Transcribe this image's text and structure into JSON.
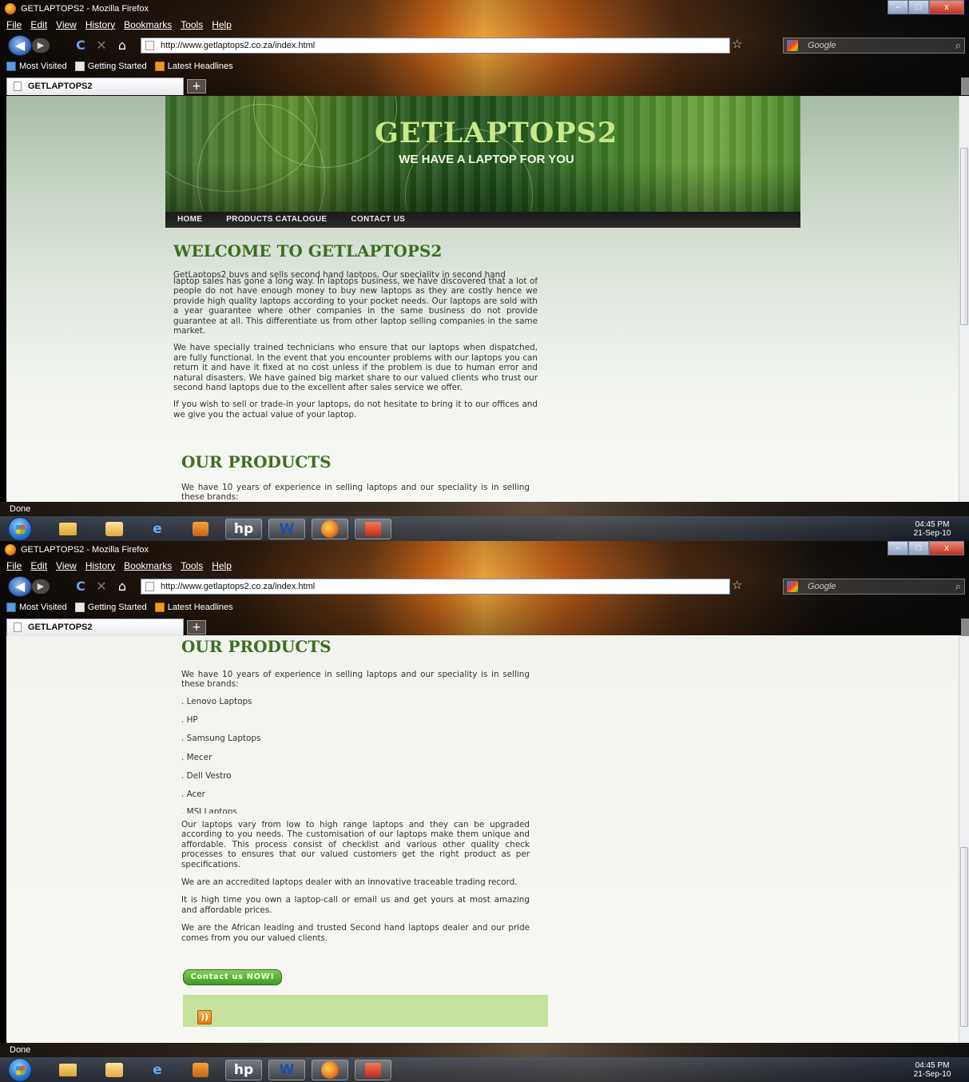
{
  "window": {
    "title": "GETLAPTOPS2 - Mozilla Firefox",
    "buttons": {
      "minimize": "–",
      "maximize": "□",
      "close": "x"
    }
  },
  "menu": [
    "File",
    "Edit",
    "View",
    "History",
    "Bookmarks",
    "Tools",
    "Help"
  ],
  "toolbar": {
    "url": "http://www.getlaptops2.co.za/index.html",
    "search_placeholder": "Google",
    "back_glyph": "◀",
    "forward_glyph": "▶",
    "reload_glyph": "C",
    "stop_glyph": "✕",
    "home_glyph": "⌂",
    "star_glyph": "☆",
    "search_glyph": "⌕"
  },
  "bookmarks": [
    "Most Visited",
    "Getting Started",
    "Latest Headlines"
  ],
  "tabs": [
    {
      "label": "GETLAPTOPS2"
    }
  ],
  "newtab_label": "+",
  "site": {
    "title": "GETLAPTOPS2",
    "tagline": "WE HAVE A LAPTOP FOR YOU",
    "nav": [
      "HOME",
      "PRODUCTS CATALOGUE",
      "CONTACT US"
    ],
    "welcome_heading": "WELCOME TO GETLAPTOPS2",
    "intro_clipped_line": "GetLaptops2 buys and sells second hand laptops. Our speciality in second hand",
    "intro_p1": "laptop sales has gone a long way. In laptops business, we have discovered that a lot of people do not have enough money to buy new laptops as they are costly hence we provide high quality laptops according to your pocket needs. Our laptops are sold with a year guarantee where other companies in the same business do not provide guarantee at all. This differentiate us from other laptop selling companies in the same market.",
    "intro_p2": "We have specially trained technicians who ensure that our laptops when dispatched, are fully functional. In the event that you encounter problems with our laptops you can return it and have it fixed at no cost unless if the problem is due to human error and natural disasters. We have gained big market share to our valued clients who trust our second hand laptops due to the excellent after sales service we offer.",
    "intro_p3": "If you wish to sell or trade-in your laptops, do not hesitate to bring it to our offices and we give you the actual value of your laptop.",
    "products_heading": "OUR PRODUCTS",
    "products_intro": "We have 10 years of experience in selling laptops and our speciality is in selling these brands:",
    "brands": [
      ". Lenovo Laptops",
      ". HP",
      ". Samsung Laptops",
      ". Mecer",
      ". Dell Vestro",
      ". Acer"
    ],
    "brand_clipped": ". MSI Laptops",
    "products_p1": "Our laptops vary from low to high range laptops and they can be upgraded according to you needs. The customisation of our laptops make them unique and affordable. This process consist of checklist and various other quality check processes to ensures that our valued customers get the right product as per specifications.",
    "products_p2": "We are an accredited laptops dealer with an innovative traceable trading record.",
    "products_p3": "It is high time you own a laptop-call or email us and get yours at most amazing and affordable prices.",
    "products_p4": "We are the African leading and trusted Second hand laptops dealer and our pride comes from you our valued clients.",
    "contact_button": "Contact us NOW!",
    "rss_glyph": "))"
  },
  "status": "Done",
  "clock": {
    "time": "04:45 PM",
    "date": "21-Sep-10"
  },
  "taskbar_glyphs": {
    "hp": "hp",
    "word": "W",
    "ie": "e"
  },
  "colors": {
    "heading_green": "#3d6d22",
    "banner_title": "#c9e88a",
    "button_green": "#3f9a22",
    "footer_green": "#c6e29c"
  }
}
